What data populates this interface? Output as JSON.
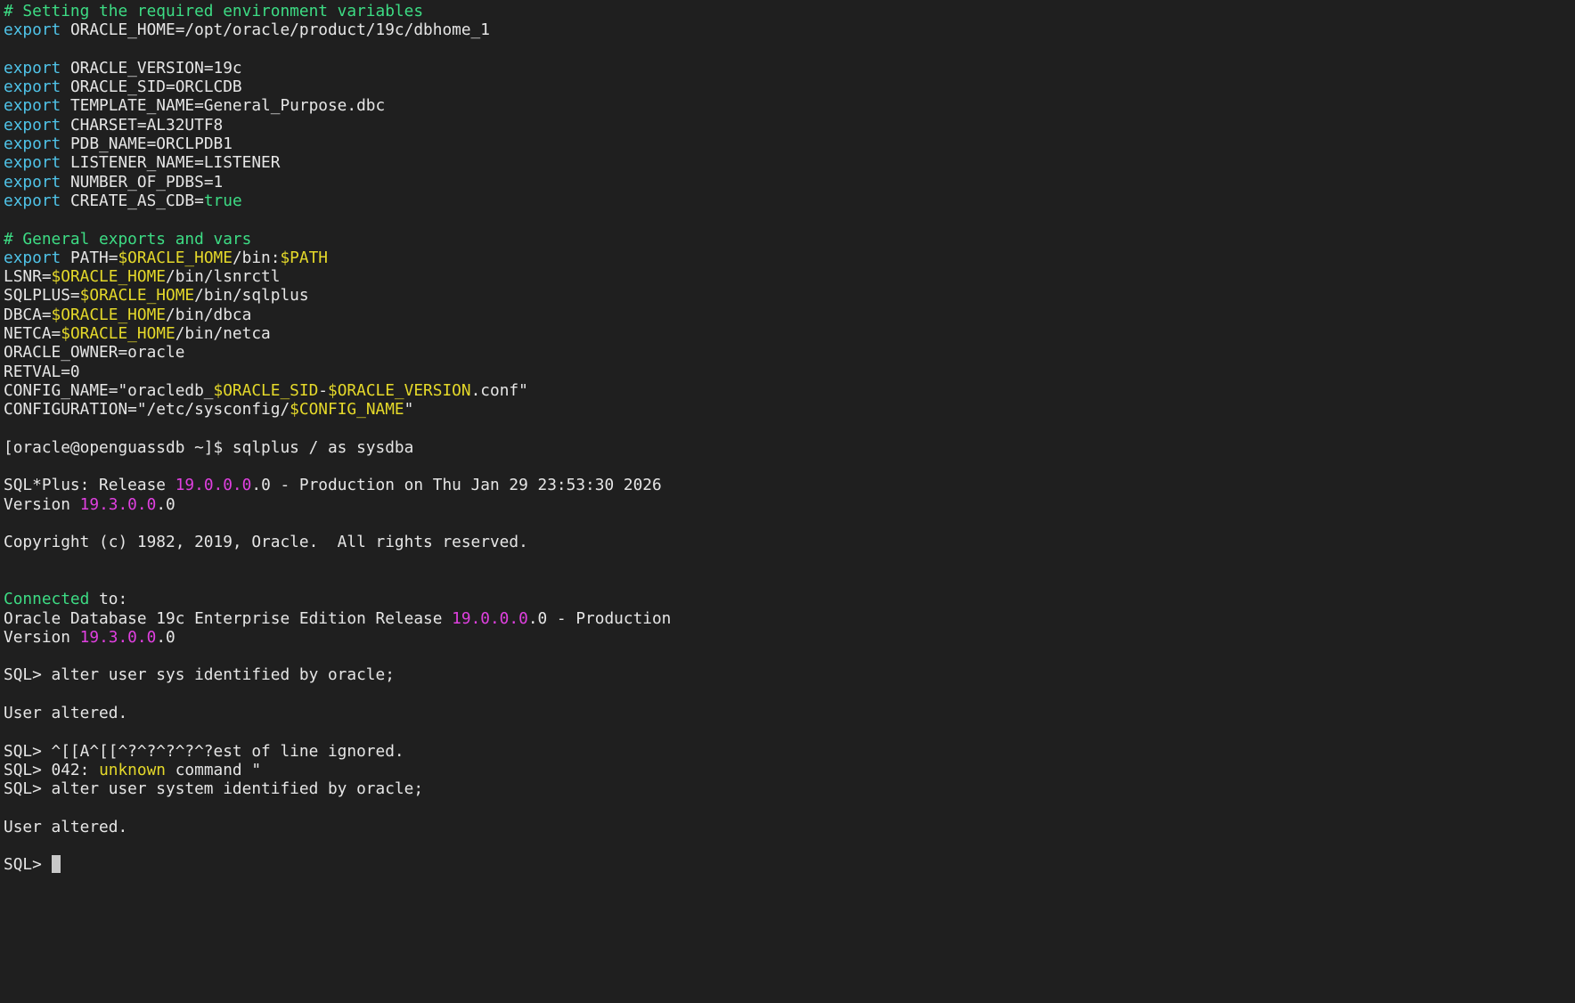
{
  "terminal": {
    "background": "#1f1f1f",
    "colors": {
      "default": "#e6e6e6",
      "comment": "#3ddc84",
      "keyword": "#4fc3e8",
      "variable": "#e5d92a",
      "number": "#e040e0",
      "boolean": "#3ddc84",
      "success": "#3ddc84",
      "error": "#e5d92a"
    },
    "lines": [
      [
        {
          "text": "# Setting the required environment variables",
          "style": "comment"
        }
      ],
      [
        {
          "text": "export",
          "style": "keyword"
        },
        {
          "text": " ORACLE_HOME=/opt/oracle/product/19c/dbhome_1",
          "style": "default"
        }
      ],
      [],
      [
        {
          "text": "export",
          "style": "keyword"
        },
        {
          "text": " ORACLE_VERSION=19c",
          "style": "default"
        }
      ],
      [
        {
          "text": "export",
          "style": "keyword"
        },
        {
          "text": " ORACLE_SID=ORCLCDB",
          "style": "default"
        }
      ],
      [
        {
          "text": "export",
          "style": "keyword"
        },
        {
          "text": " TEMPLATE_NAME=General_Purpose.dbc",
          "style": "default"
        }
      ],
      [
        {
          "text": "export",
          "style": "keyword"
        },
        {
          "text": " CHARSET=AL32UTF8",
          "style": "default"
        }
      ],
      [
        {
          "text": "export",
          "style": "keyword"
        },
        {
          "text": " PDB_NAME=ORCLPDB1",
          "style": "default"
        }
      ],
      [
        {
          "text": "export",
          "style": "keyword"
        },
        {
          "text": " LISTENER_NAME=LISTENER",
          "style": "default"
        }
      ],
      [
        {
          "text": "export",
          "style": "keyword"
        },
        {
          "text": " NUMBER_OF_PDBS=1",
          "style": "default"
        }
      ],
      [
        {
          "text": "export",
          "style": "keyword"
        },
        {
          "text": " CREATE_AS_CDB=",
          "style": "default"
        },
        {
          "text": "true",
          "style": "boolean"
        }
      ],
      [],
      [
        {
          "text": "# General exports and vars",
          "style": "comment"
        }
      ],
      [
        {
          "text": "export",
          "style": "keyword"
        },
        {
          "text": " PATH=",
          "style": "default"
        },
        {
          "text": "$ORACLE_HOME",
          "style": "variable"
        },
        {
          "text": "/bin:",
          "style": "default"
        },
        {
          "text": "$PATH",
          "style": "variable"
        }
      ],
      [
        {
          "text": "LSNR=",
          "style": "default"
        },
        {
          "text": "$ORACLE_HOME",
          "style": "variable"
        },
        {
          "text": "/bin/lsnrctl",
          "style": "default"
        }
      ],
      [
        {
          "text": "SQLPLUS=",
          "style": "default"
        },
        {
          "text": "$ORACLE_HOME",
          "style": "variable"
        },
        {
          "text": "/bin/sqlplus",
          "style": "default"
        }
      ],
      [
        {
          "text": "DBCA=",
          "style": "default"
        },
        {
          "text": "$ORACLE_HOME",
          "style": "variable"
        },
        {
          "text": "/bin/dbca",
          "style": "default"
        }
      ],
      [
        {
          "text": "NETCA=",
          "style": "default"
        },
        {
          "text": "$ORACLE_HOME",
          "style": "variable"
        },
        {
          "text": "/bin/netca",
          "style": "default"
        }
      ],
      [
        {
          "text": "ORACLE_OWNER=oracle",
          "style": "default"
        }
      ],
      [
        {
          "text": "RETVAL=0",
          "style": "default"
        }
      ],
      [
        {
          "text": "CONFIG_NAME=\"oracledb_",
          "style": "default"
        },
        {
          "text": "$ORACLE_SID",
          "style": "variable"
        },
        {
          "text": "-",
          "style": "default"
        },
        {
          "text": "$ORACLE_VERSION",
          "style": "variable"
        },
        {
          "text": ".conf\"",
          "style": "default"
        }
      ],
      [
        {
          "text": "CONFIGURATION=\"/etc/sysconfig/",
          "style": "default"
        },
        {
          "text": "$CONFIG_NAME",
          "style": "variable"
        },
        {
          "text": "\"",
          "style": "default"
        }
      ],
      [],
      [
        {
          "text": "[oracle@openguassdb ~]$ sqlplus / as sysdba",
          "style": "default"
        }
      ],
      [],
      [
        {
          "text": "SQL*Plus: Release ",
          "style": "default"
        },
        {
          "text": "19.0.0.0",
          "style": "number"
        },
        {
          "text": ".0 - Production on Thu Jan 29 23:53:30 2026",
          "style": "default"
        }
      ],
      [
        {
          "text": "Version ",
          "style": "default"
        },
        {
          "text": "19.3.0.0",
          "style": "number"
        },
        {
          "text": ".0",
          "style": "default"
        }
      ],
      [],
      [
        {
          "text": "Copyright (c) 1982, 2019, Oracle.  All rights reserved.",
          "style": "default"
        }
      ],
      [],
      [],
      [
        {
          "text": "Connected",
          "style": "success"
        },
        {
          "text": " to:",
          "style": "default"
        }
      ],
      [
        {
          "text": "Oracle Database 19c Enterprise Edition Release ",
          "style": "default"
        },
        {
          "text": "19.0.0.0",
          "style": "number"
        },
        {
          "text": ".0 - Production",
          "style": "default"
        }
      ],
      [
        {
          "text": "Version ",
          "style": "default"
        },
        {
          "text": "19.3.0.0",
          "style": "number"
        },
        {
          "text": ".0",
          "style": "default"
        }
      ],
      [],
      [
        {
          "text": "SQL> alter user sys identified by oracle;",
          "style": "default"
        }
      ],
      [],
      [
        {
          "text": "User altered.",
          "style": "default"
        }
      ],
      [],
      [
        {
          "text": "SQL> ^[[A^[[^?^?^?^?^?est of line ignored.",
          "style": "default"
        }
      ],
      [
        {
          "text": "SQL> 042: ",
          "style": "default"
        },
        {
          "text": "unknown",
          "style": "error"
        },
        {
          "text": " command \"",
          "style": "default"
        }
      ],
      [
        {
          "text": "SQL> alter user system identified by oracle;",
          "style": "default"
        }
      ],
      [],
      [
        {
          "text": "User altered.",
          "style": "default"
        }
      ],
      [],
      [
        {
          "text": "SQL> ",
          "style": "default"
        },
        {
          "cursor": true
        }
      ]
    ]
  }
}
